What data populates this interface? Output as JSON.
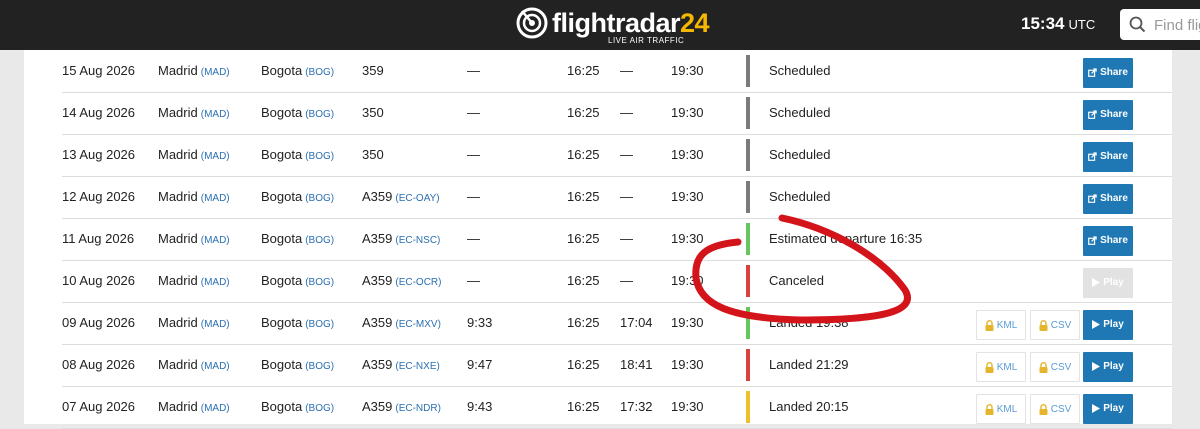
{
  "header": {
    "logo_word": "flightradar",
    "logo_number": "24",
    "logo_tagline": "LIVE AIR TRAFFIC",
    "clock_time": "15:34",
    "clock_zone": "UTC",
    "search_placeholder": "Find flig"
  },
  "colors": {
    "scheduled": "#7a7a7a",
    "green": "#67c55f",
    "red": "#d9413c",
    "yellow": "#efc02c",
    "button_blue": "#1f78b4",
    "annotation_red": "#d4141b"
  },
  "buttons": {
    "share": "Share",
    "play": "Play",
    "kml": "KML",
    "csv": "CSV"
  },
  "flights": [
    {
      "date": "15 Aug 2026",
      "from": "Madrid",
      "from_code": "(MAD)",
      "to": "Bogota",
      "to_code": "(BOG)",
      "aircraft": "359",
      "reg": "",
      "flight_time": "—",
      "std": "16:25",
      "atd": "—",
      "sta": "19:30",
      "status": "Scheduled",
      "status_color": "scheduled",
      "actions": "share"
    },
    {
      "date": "14 Aug 2026",
      "from": "Madrid",
      "from_code": "(MAD)",
      "to": "Bogota",
      "to_code": "(BOG)",
      "aircraft": "350",
      "reg": "",
      "flight_time": "—",
      "std": "16:25",
      "atd": "—",
      "sta": "19:30",
      "status": "Scheduled",
      "status_color": "scheduled",
      "actions": "share"
    },
    {
      "date": "13 Aug 2026",
      "from": "Madrid",
      "from_code": "(MAD)",
      "to": "Bogota",
      "to_code": "(BOG)",
      "aircraft": "350",
      "reg": "",
      "flight_time": "—",
      "std": "16:25",
      "atd": "—",
      "sta": "19:30",
      "status": "Scheduled",
      "status_color": "scheduled",
      "actions": "share"
    },
    {
      "date": "12 Aug 2026",
      "from": "Madrid",
      "from_code": "(MAD)",
      "to": "Bogota",
      "to_code": "(BOG)",
      "aircraft": "A359",
      "reg": "(EC-OAY)",
      "flight_time": "—",
      "std": "16:25",
      "atd": "—",
      "sta": "19:30",
      "status": "Scheduled",
      "status_color": "scheduled",
      "actions": "share"
    },
    {
      "date": "11 Aug 2026",
      "from": "Madrid",
      "from_code": "(MAD)",
      "to": "Bogota",
      "to_code": "(BOG)",
      "aircraft": "A359",
      "reg": "(EC-NSC)",
      "flight_time": "—",
      "std": "16:25",
      "atd": "—",
      "sta": "19:30",
      "status": "Estimated departure 16:35",
      "status_color": "green",
      "actions": "share"
    },
    {
      "date": "10 Aug 2026",
      "from": "Madrid",
      "from_code": "(MAD)",
      "to": "Bogota",
      "to_code": "(BOG)",
      "aircraft": "A359",
      "reg": "(EC-OCR)",
      "flight_time": "—",
      "std": "16:25",
      "atd": "—",
      "sta": "19:30",
      "status": "Canceled",
      "status_color": "red",
      "actions": "play-disabled"
    },
    {
      "date": "09 Aug 2026",
      "from": "Madrid",
      "from_code": "(MAD)",
      "to": "Bogota",
      "to_code": "(BOG)",
      "aircraft": "A359",
      "reg": "(EC-MXV)",
      "flight_time": "9:33",
      "std": "16:25",
      "atd": "17:04",
      "sta": "19:30",
      "status": "Landed 19:38",
      "status_color": "green",
      "actions": "full"
    },
    {
      "date": "08 Aug 2026",
      "from": "Madrid",
      "from_code": "(MAD)",
      "to": "Bogota",
      "to_code": "(BOG)",
      "aircraft": "A359",
      "reg": "(EC-NXE)",
      "flight_time": "9:47",
      "std": "16:25",
      "atd": "18:41",
      "sta": "19:30",
      "status": "Landed 21:29",
      "status_color": "red",
      "actions": "full"
    },
    {
      "date": "07 Aug 2026",
      "from": "Madrid",
      "from_code": "(MAD)",
      "to": "Bogota",
      "to_code": "(BOG)",
      "aircraft": "A359",
      "reg": "(EC-NDR)",
      "flight_time": "9:43",
      "std": "16:25",
      "atd": "17:32",
      "sta": "19:30",
      "status": "Landed 20:15",
      "status_color": "yellow",
      "actions": "full"
    }
  ]
}
